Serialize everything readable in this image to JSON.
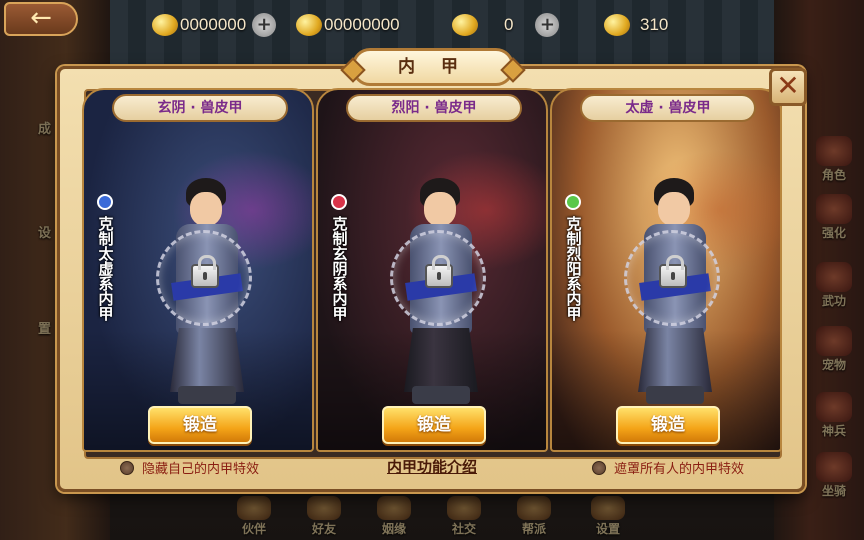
{
  "topbar": {
    "back_icon": "back-arrow-icon",
    "resources": [
      {
        "icon": "gold-coin-icon",
        "value": "0000000",
        "has_plus": true
      },
      {
        "icon": "gold-ingot-icon",
        "value": "00000000",
        "has_plus": false
      },
      {
        "icon": "ingot-icon",
        "value": "0",
        "has_plus": true
      },
      {
        "icon": "token-icon",
        "value": "310",
        "has_plus": false
      }
    ]
  },
  "modal": {
    "title": "内 甲",
    "close_label": "✕",
    "cards": [
      {
        "banner": "玄阴 · 兽皮甲",
        "counter_text": "克制太虚系内甲",
        "orb_color": "#3a6ad8",
        "locked": true,
        "forge_label": "锻造"
      },
      {
        "banner": "烈阳 · 兽皮甲",
        "counter_text": "克制玄阴系内甲",
        "orb_color": "#d8344a",
        "locked": true,
        "forge_label": "锻造"
      },
      {
        "banner": "太虚 · 兽皮甲",
        "counter_text": "克制烈阳系内甲",
        "orb_color": "#5ac84a",
        "locked": true,
        "forge_label": "锻造"
      }
    ],
    "hide_own_label": "隐藏自己的内甲特效",
    "intro_label": "内甲功能介绍",
    "mask_all_label": "遮罩所有人的内甲特效"
  },
  "side_menu": [
    "角色",
    "强化",
    "武功",
    "宠物",
    "神兵",
    "坐骑"
  ],
  "bottom_menu": [
    "伙伴",
    "好友",
    "姻缘",
    "社交",
    "帮派",
    "设置"
  ],
  "left_menu_partial": [
    "成",
    "设",
    "置"
  ]
}
